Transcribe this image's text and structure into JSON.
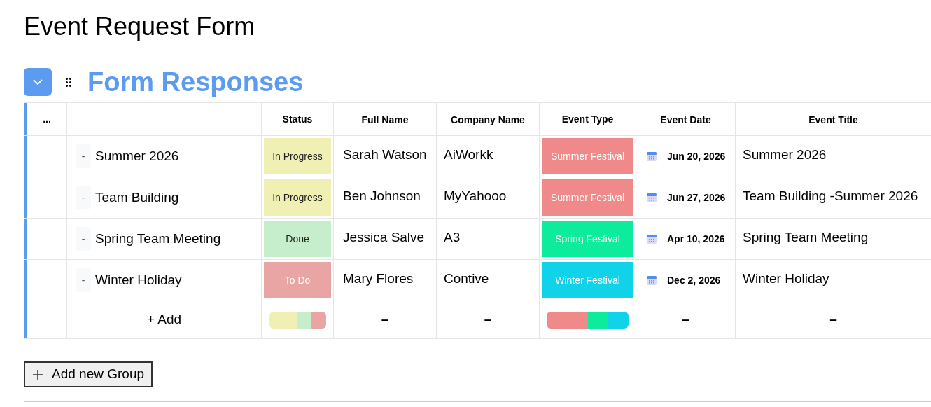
{
  "title": "Event Request Form",
  "group": {
    "title": "Form Responses",
    "expanded": true,
    "menu_label": "...",
    "columns": [
      "Status",
      "Full Name",
      "Company Name",
      "Event Type",
      "Event Date",
      "Event Title"
    ],
    "rows": [
      {
        "marker": "-",
        "item": "Summer 2026",
        "status": {
          "label": "In Progress",
          "color": "#f0f0b4"
        },
        "full_name": "Sarah Watson",
        "company": "AiWorkk",
        "event_type": {
          "label": "Summer Festival",
          "color": "#f08a8a"
        },
        "event_date": "Jun 20, 2026",
        "event_title": "Summer 2026"
      },
      {
        "marker": "-",
        "item": "Team Building",
        "status": {
          "label": "In Progress",
          "color": "#f0f0b4"
        },
        "full_name": "Ben Johnson",
        "company": "MyYahooo",
        "event_type": {
          "label": "Summer Festival",
          "color": "#f08a8a"
        },
        "event_date": "Jun 27, 2026",
        "event_title": "Team Building -Summer 2026"
      },
      {
        "marker": "-",
        "item": "Spring Team Meeting",
        "status": {
          "label": "Done",
          "color": "#c6eecd"
        },
        "full_name": "Jessica Salve",
        "company": "A3",
        "event_type": {
          "label": "Spring Festival",
          "color": "#0deb9c"
        },
        "event_date": "Apr 10, 2026",
        "event_title": "Spring Team Meeting"
      },
      {
        "marker": "-",
        "item": "Winter Holiday",
        "status": {
          "label": "To Do",
          "color": "#e9a4a4"
        },
        "full_name": "Mary Flores",
        "company": "Contive",
        "event_type": {
          "label": "Winter Festival",
          "color": "#10d3ea"
        },
        "event_date": "Dec 2, 2026",
        "event_title": "Winter Holiday"
      }
    ],
    "summary": {
      "add_label": "+ Add",
      "status": [
        {
          "color": "#f0f0b4"
        },
        {
          "color": "#c6eecd"
        },
        {
          "color": "#e9a4a4"
        }
      ],
      "full_name": "–",
      "company": "–",
      "event_type": [
        {
          "color": "#f08a8a"
        },
        {
          "color": "#0deb9c"
        },
        {
          "color": "#10d3ea"
        }
      ],
      "event_date": "–",
      "event_title": "–"
    }
  },
  "add_group_button": "Add new Group"
}
